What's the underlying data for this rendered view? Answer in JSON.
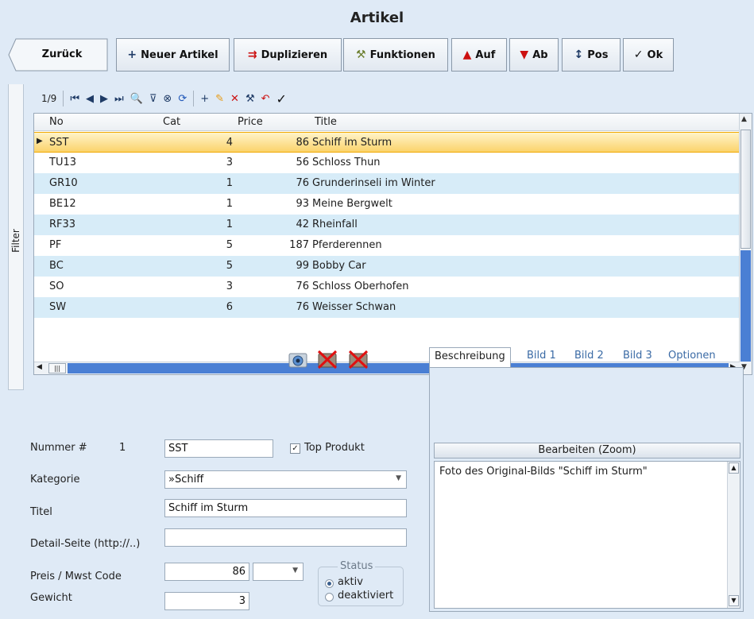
{
  "window_title": "Artikel",
  "toolbar": {
    "back": "Zurück",
    "new_article": "Neuer Artikel",
    "duplicate": "Duplizieren",
    "functions": "Funktionen",
    "up": "Auf",
    "down": "Ab",
    "pos": "Pos",
    "ok": "Ok"
  },
  "filter_label": "Filter",
  "navigator": {
    "position": "1/9"
  },
  "grid": {
    "columns": [
      "No",
      "Cat",
      "Price",
      "Title"
    ],
    "rows": [
      {
        "no": "SST",
        "cat": "4",
        "price": "86",
        "title": "Schiff im Sturm"
      },
      {
        "no": "TU13",
        "cat": "3",
        "price": "56",
        "title": "Schloss Thun"
      },
      {
        "no": "GR10",
        "cat": "1",
        "price": "76",
        "title": "Grunderinseli im Winter"
      },
      {
        "no": "BE12",
        "cat": "1",
        "price": "93",
        "title": "Meine Bergwelt"
      },
      {
        "no": "RF33",
        "cat": "1",
        "price": "42",
        "title": "Rheinfall"
      },
      {
        "no": "PF",
        "cat": "5",
        "price": "187",
        "title": "Pferderennen"
      },
      {
        "no": "BC",
        "cat": "5",
        "price": "99",
        "title": "Bobby Car"
      },
      {
        "no": "SO",
        "cat": "3",
        "price": "76",
        "title": "Schloss Oberhofen"
      },
      {
        "no": "SW",
        "cat": "6",
        "price": "76",
        "title": "Weisser Schwan"
      }
    ]
  },
  "form": {
    "nummer_label": "Nummer #",
    "nummer_index": "1",
    "nummer_value": "SST",
    "top_produkt_label": "Top Produkt",
    "kategorie_label": "Kategorie",
    "kategorie_value": "»Schiff",
    "titel_label": "Titel",
    "titel_value": "Schiff im Sturm",
    "detail_label": "Detail-Seite (http://..)",
    "detail_value": "",
    "preis_label": "Preis / Mwst Code",
    "preis_value": "86",
    "mwst_value": "",
    "gewicht_label": "Gewicht",
    "gewicht_value": "3",
    "status_label": "Status",
    "status_aktiv": "aktiv",
    "status_deaktiviert": "deaktiviert"
  },
  "tabs": {
    "beschreibung": "Beschreibung",
    "bild1": "Bild 1",
    "bild2": "Bild 2",
    "bild3": "Bild 3",
    "optionen": "Optionen"
  },
  "description": {
    "edit_button": "Bearbeiten (Zoom)",
    "text": "Foto des Original-Bilds \"Schiff im Sturm\""
  }
}
